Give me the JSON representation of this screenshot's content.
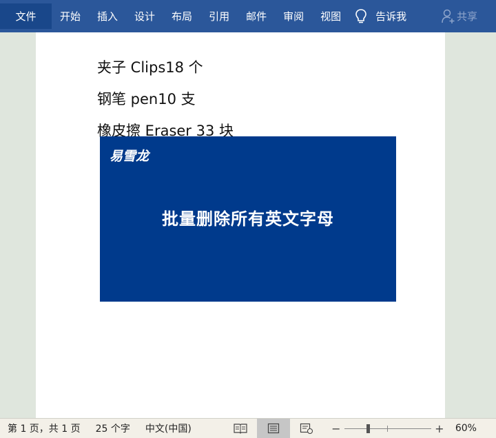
{
  "ribbon": {
    "tabs": [
      "文件",
      "开始",
      "插入",
      "设计",
      "布局",
      "引用",
      "邮件",
      "审阅",
      "视图"
    ],
    "tell_me": "告诉我",
    "share": "共享"
  },
  "document": {
    "lines": [
      "夹子 Clips18 个",
      "钢笔 pen10 支",
      "橡皮擦 Eraser 33 块"
    ]
  },
  "banner": {
    "brand": "易雪龙",
    "headline": "批量删除所有英文字母",
    "background": "#003a8c"
  },
  "status": {
    "page": "第 1 页，共 1 页",
    "words": "25 个字",
    "language": "中文(中国)",
    "zoom": "60%",
    "zoom_level": 0.6
  },
  "colors": {
    "ribbon": "#2b579a",
    "file_tab": "#19478a",
    "page_bg": "#dfe6dd"
  }
}
